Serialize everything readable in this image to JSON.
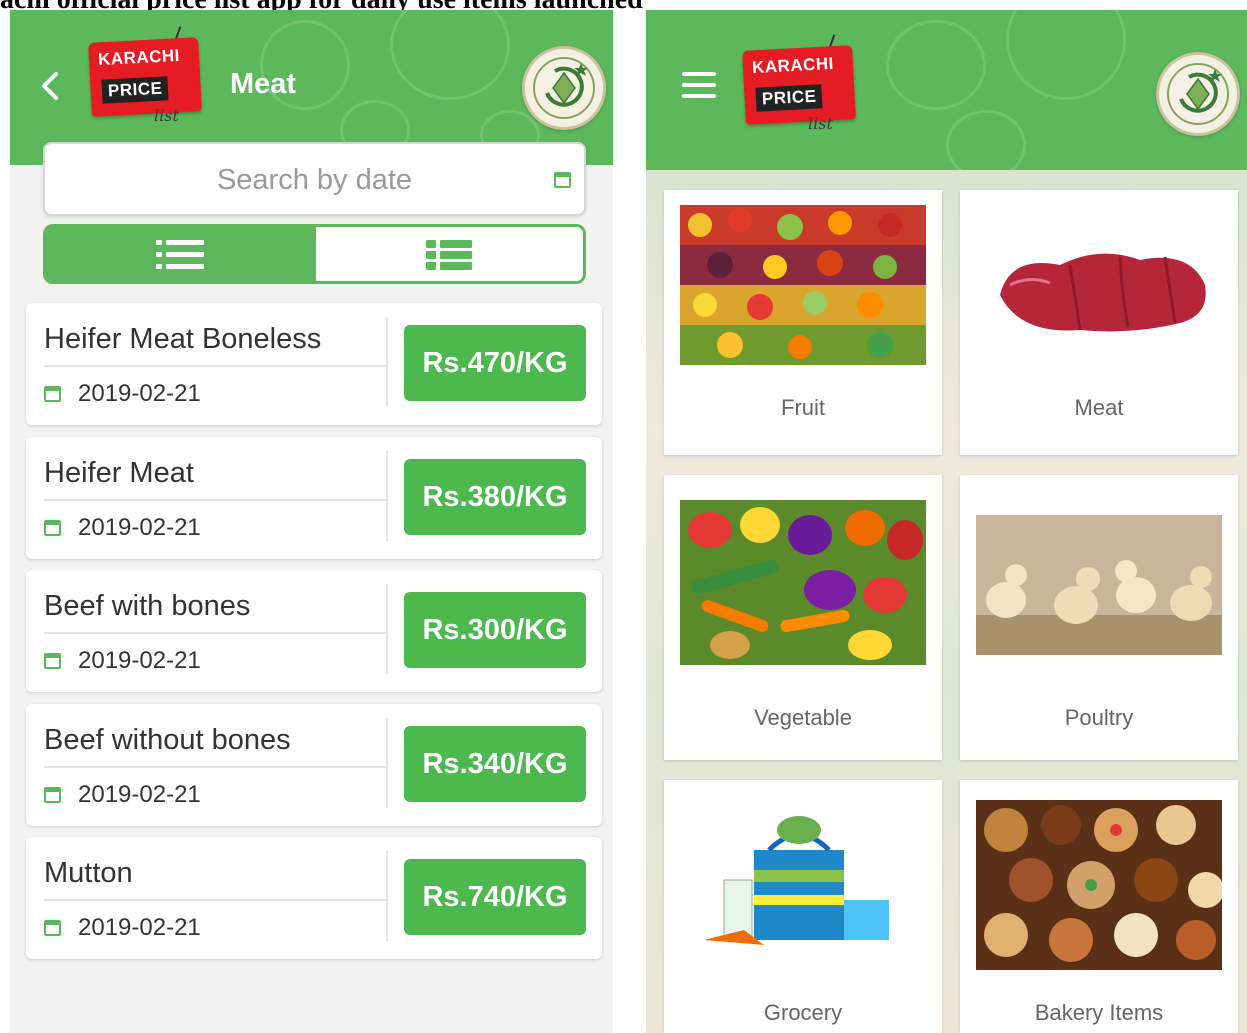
{
  "headline": "achi official price list app for daily use items launched",
  "app": {
    "logo": {
      "line1": "KARACHI",
      "line2": "PRICE",
      "line3": "list"
    }
  },
  "left_screen": {
    "title": "Meat",
    "search": {
      "placeholder": "Search by date"
    },
    "items": [
      {
        "name": "Heifer Meat Boneless",
        "date": "2019-02-21",
        "price": "Rs.470/KG"
      },
      {
        "name": "Heifer Meat",
        "date": "2019-02-21",
        "price": "Rs.380/KG"
      },
      {
        "name": "Beef with bones",
        "date": "2019-02-21",
        "price": "Rs.300/KG"
      },
      {
        "name": "Beef without bones",
        "date": "2019-02-21",
        "price": "Rs.340/KG"
      },
      {
        "name": "Mutton",
        "date": "2019-02-21",
        "price": "Rs.740/KG"
      }
    ]
  },
  "right_screen": {
    "categories": [
      {
        "label": "Fruit",
        "image": "fruit-photo"
      },
      {
        "label": "Meat",
        "image": "meat-photo"
      },
      {
        "label": "Vegetable",
        "image": "vegetable-photo"
      },
      {
        "label": "Poultry",
        "image": "poultry-photo"
      },
      {
        "label": "Grocery",
        "image": "grocery-photo"
      },
      {
        "label": "Bakery Items",
        "image": "bakery-photo"
      }
    ]
  },
  "colors": {
    "primary_green": "#5cb85a",
    "price_green": "#4cb84d",
    "logo_red": "#e51c23"
  }
}
